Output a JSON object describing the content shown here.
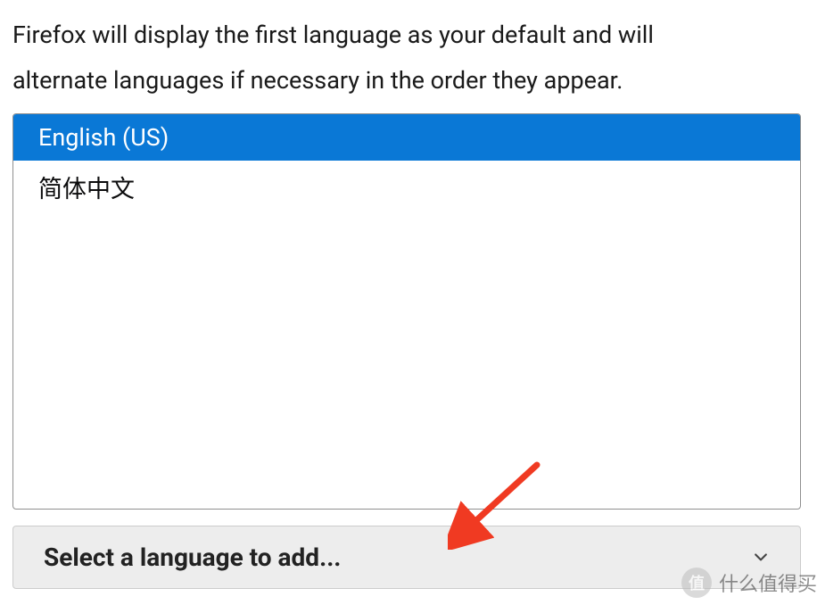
{
  "description": {
    "line1": "Firefox will display the first language as your default and will",
    "line2": "alternate languages if necessary in the order they appear."
  },
  "language_list": {
    "items": [
      {
        "label": "English (US)",
        "selected": true
      },
      {
        "label": "简体中文",
        "selected": false
      }
    ]
  },
  "add_language_select": {
    "label": "Select a language to add..."
  },
  "watermark": {
    "badge": "值",
    "text": "什么值得买"
  },
  "annotation": {
    "color": "#f03a22"
  }
}
